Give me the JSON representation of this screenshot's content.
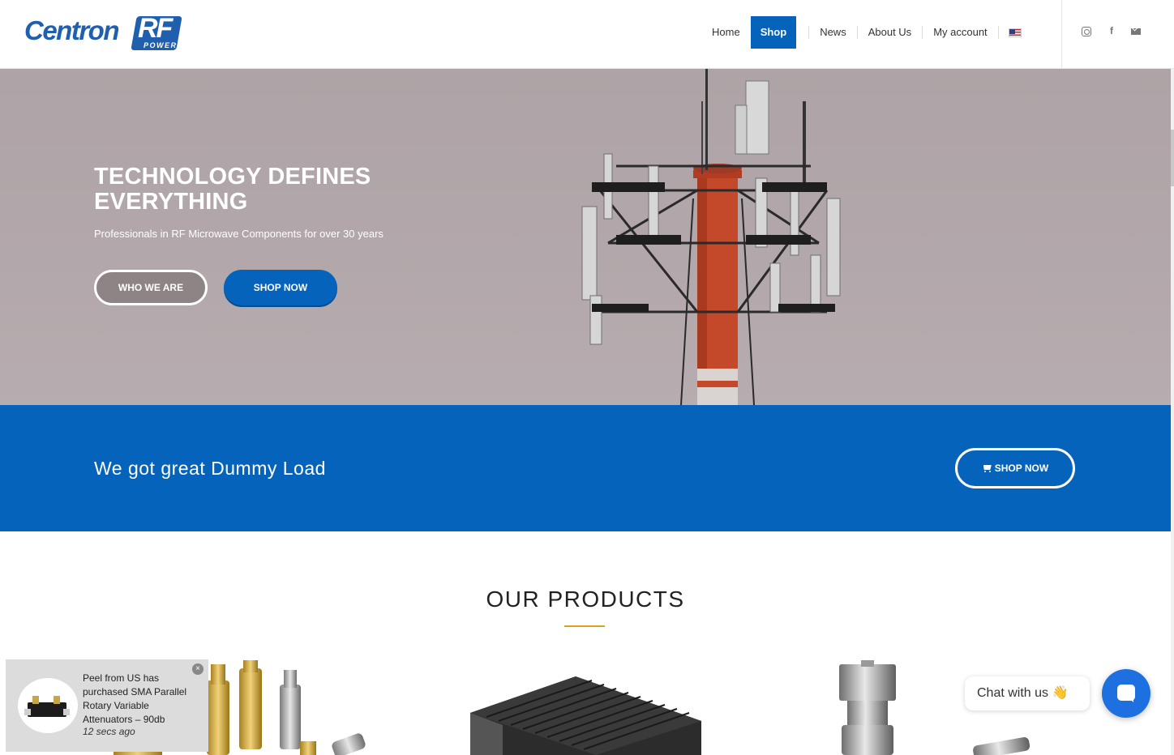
{
  "brand": {
    "logo_main": "Centron",
    "logo_badge": "RF",
    "logo_sub": "POWER"
  },
  "nav": {
    "items": [
      {
        "label": "Home",
        "active": false
      },
      {
        "label": "Shop",
        "active": true
      },
      {
        "label": "News",
        "active": false
      },
      {
        "label": "About Us",
        "active": false
      },
      {
        "label": "My account",
        "active": false
      }
    ]
  },
  "hero": {
    "title": "TECHNOLOGY DEFINES EVERYTHING",
    "subtitle": "Professionals in RF Microwave Components for over 30 years",
    "primary_button": "WHO WE ARE",
    "secondary_button": "SHOP NOW"
  },
  "band": {
    "text": "We got great Dummy Load",
    "button": "SHOP NOW"
  },
  "products": {
    "title": "OUR PRODUCTS"
  },
  "notification": {
    "message": "Peel from US has purchased SMA Parallel Rotary Variable Attenuators – 90db",
    "time": "12 secs ago",
    "close": "×"
  },
  "chat": {
    "bubble_text": "Chat with us 👋"
  },
  "colors": {
    "brand_blue": "#0563bb",
    "accent_gold": "#d9a320"
  }
}
